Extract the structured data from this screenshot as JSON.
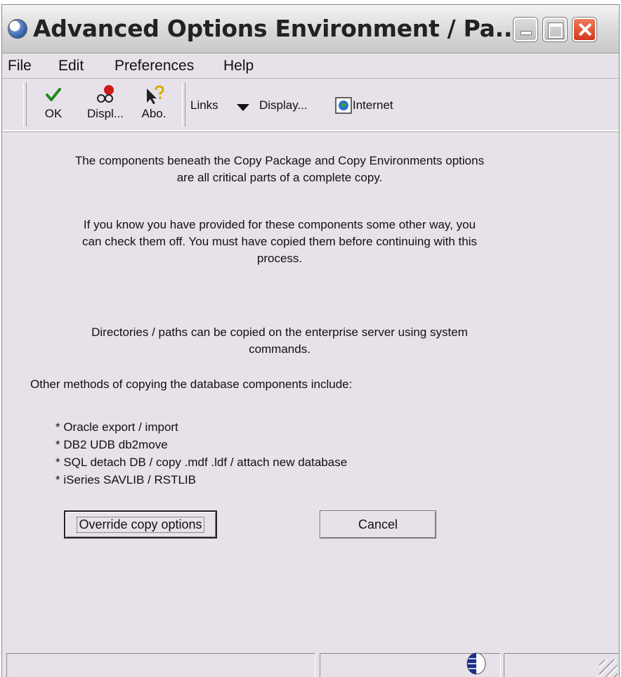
{
  "window": {
    "title": "Advanced Options Environment / Pa...",
    "icon": "app-globe-icon",
    "controls": [
      "minimize",
      "maximize",
      "close"
    ]
  },
  "menu": {
    "file": "File",
    "edit": "Edit",
    "preferences": "Preferences",
    "help": "Help"
  },
  "toolbar": {
    "ok": {
      "label": "OK",
      "icon": "checkmark-icon",
      "color": "#1f8a1f"
    },
    "display": {
      "label": "Displ...",
      "icon": "glasses-icon",
      "color": "#d01818"
    },
    "about": {
      "label": "Abo.",
      "icon": "question-pointer-icon",
      "color": "#d8b000"
    },
    "links": "Links",
    "display_menu": "Display...",
    "internet": "Internet"
  },
  "content": {
    "para1_line1": "The components beneath the Copy Package and Copy Environments options",
    "para1_line2": "are all critical parts of a complete copy.",
    "para2_line1": "If you know you have provided for these components some other way, you",
    "para2_line2": "can check them off.  You must have copied them before continuing with this",
    "para2_line3": "process.",
    "para3_line1": "Directories / paths can be copied on the enterprise server using system",
    "para3_line2": "commands.",
    "para4": "Other methods of copying the database components include:",
    "methods": [
      "* Oracle export / import",
      "* DB2 UDB db2move",
      "* SQL detach DB / copy .mdf .ldf / attach new database",
      "* iSeries SAVLIB / RSTLIB"
    ]
  },
  "buttons": {
    "override": "Override copy options",
    "cancel": "Cancel"
  },
  "statusbar": {
    "icon": "activity-globe-icon"
  }
}
